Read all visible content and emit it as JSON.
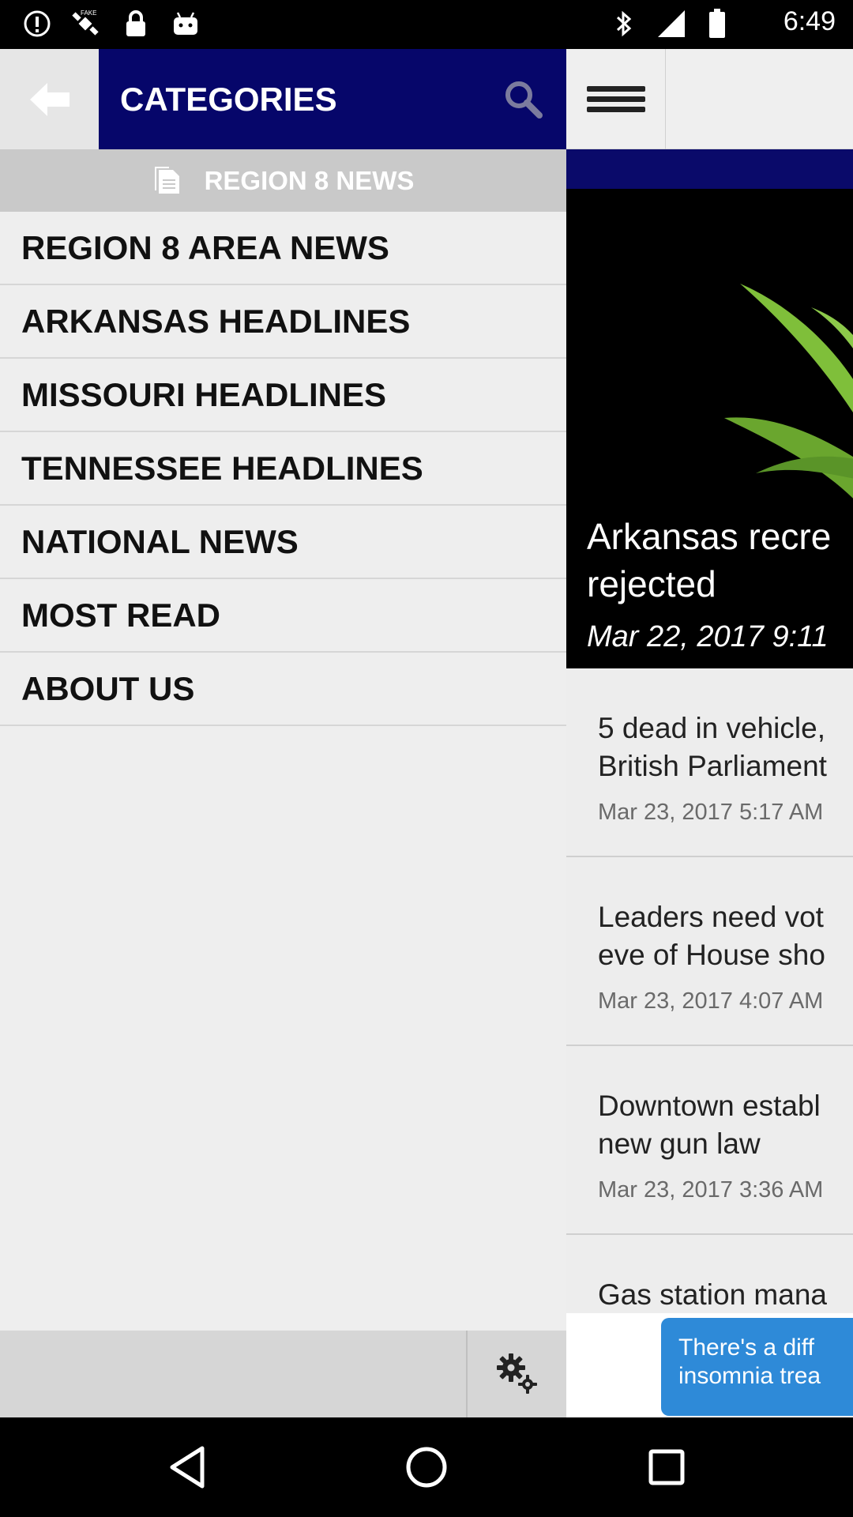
{
  "status_bar": {
    "time": "6:49",
    "icons": [
      "alert-icon",
      "fake-gps-icon",
      "lock-icon",
      "android-icon",
      "bluetooth-icon",
      "signal-icon",
      "battery-icon"
    ]
  },
  "drawer": {
    "title": "CATEGORIES",
    "section_label": "REGION 8 NEWS",
    "items": [
      {
        "label": "REGION 8 AREA NEWS"
      },
      {
        "label": "ARKANSAS HEADLINES"
      },
      {
        "label": "MISSOURI HEADLINES"
      },
      {
        "label": "TENNESSEE HEADLINES"
      },
      {
        "label": "NATIONAL NEWS"
      },
      {
        "label": "MOST READ"
      },
      {
        "label": "ABOUT US"
      }
    ]
  },
  "feed": {
    "hero": {
      "title_line1": "Arkansas recre",
      "title_line2": "rejected",
      "date": "Mar 22, 2017 9:11"
    },
    "stories": [
      {
        "title_line1": "5 dead in vehicle,",
        "title_line2": "British Parliament",
        "date": "Mar 23, 2017 5:17 AM"
      },
      {
        "title_line1": "Leaders need vot",
        "title_line2": "eve of House sho",
        "date": "Mar 23, 2017 4:07 AM"
      },
      {
        "title_line1": "Downtown establ",
        "title_line2": "new gun law",
        "date": "Mar 23, 2017 3:36 AM"
      },
      {
        "title_line1": "Gas station mana",
        "title_line2": "",
        "date": ""
      }
    ]
  },
  "ad": {
    "line1": "There's a diff",
    "line2": "insomnia trea"
  },
  "colors": {
    "navy": "#06066a",
    "drawer_bg": "#eeeeee",
    "section_bg": "#c9c9c9"
  }
}
